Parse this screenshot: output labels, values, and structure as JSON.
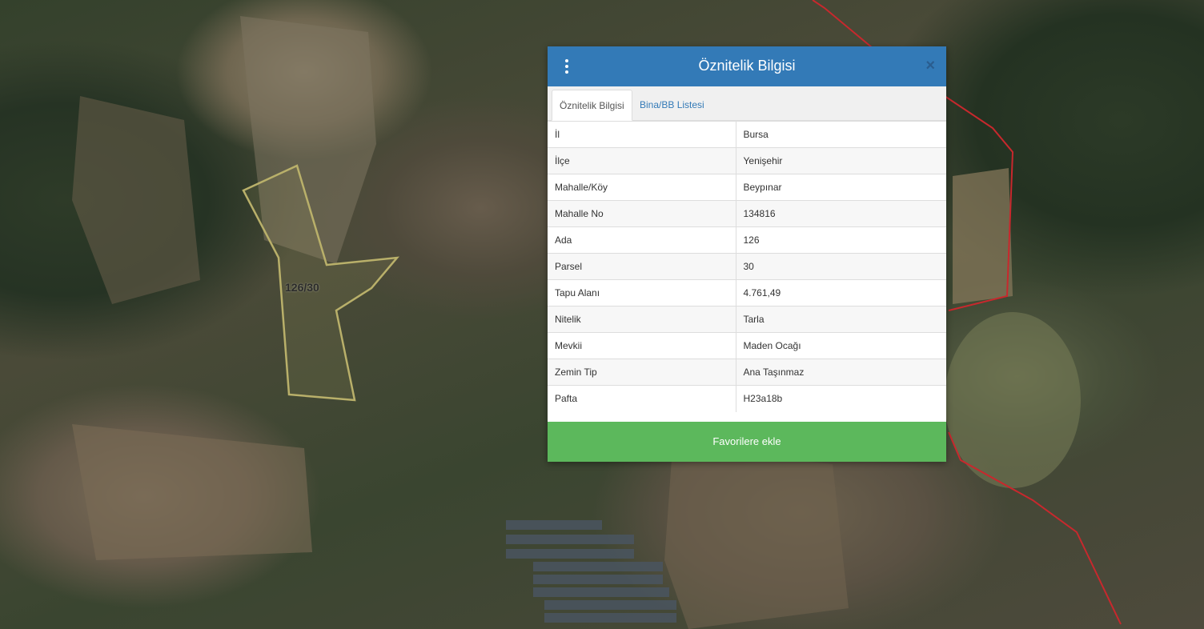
{
  "map": {
    "parcel_label": "126/30",
    "boundary_color": "#c8282d",
    "parcel_outline_color": "#b9b06a"
  },
  "panel": {
    "title": "Öznitelik Bilgisi",
    "menu_icon": "vertical-dots-icon",
    "close_icon": "close-icon",
    "tabs": [
      {
        "label": "Öznitelik Bilgisi",
        "active": true
      },
      {
        "label": "Bina/BB Listesi",
        "active": false
      }
    ],
    "rows": [
      {
        "key": "İl",
        "value": "Bursa"
      },
      {
        "key": "İlçe",
        "value": "Yenişehir"
      },
      {
        "key": "Mahalle/Köy",
        "value": "Beypınar"
      },
      {
        "key": "Mahalle No",
        "value": "134816"
      },
      {
        "key": "Ada",
        "value": "126"
      },
      {
        "key": "Parsel",
        "value": "30"
      },
      {
        "key": "Tapu Alanı",
        "value": "4.761,49"
      },
      {
        "key": "Nitelik",
        "value": "Tarla"
      },
      {
        "key": "Mevkii",
        "value": "Maden Ocağı"
      },
      {
        "key": "Zemin Tip",
        "value": "Ana Taşınmaz"
      },
      {
        "key": "Pafta",
        "value": "H23a18b"
      }
    ],
    "favorite_button": "Favorilere ekle",
    "header_color": "#337ab7",
    "button_color": "#5cb85c"
  }
}
